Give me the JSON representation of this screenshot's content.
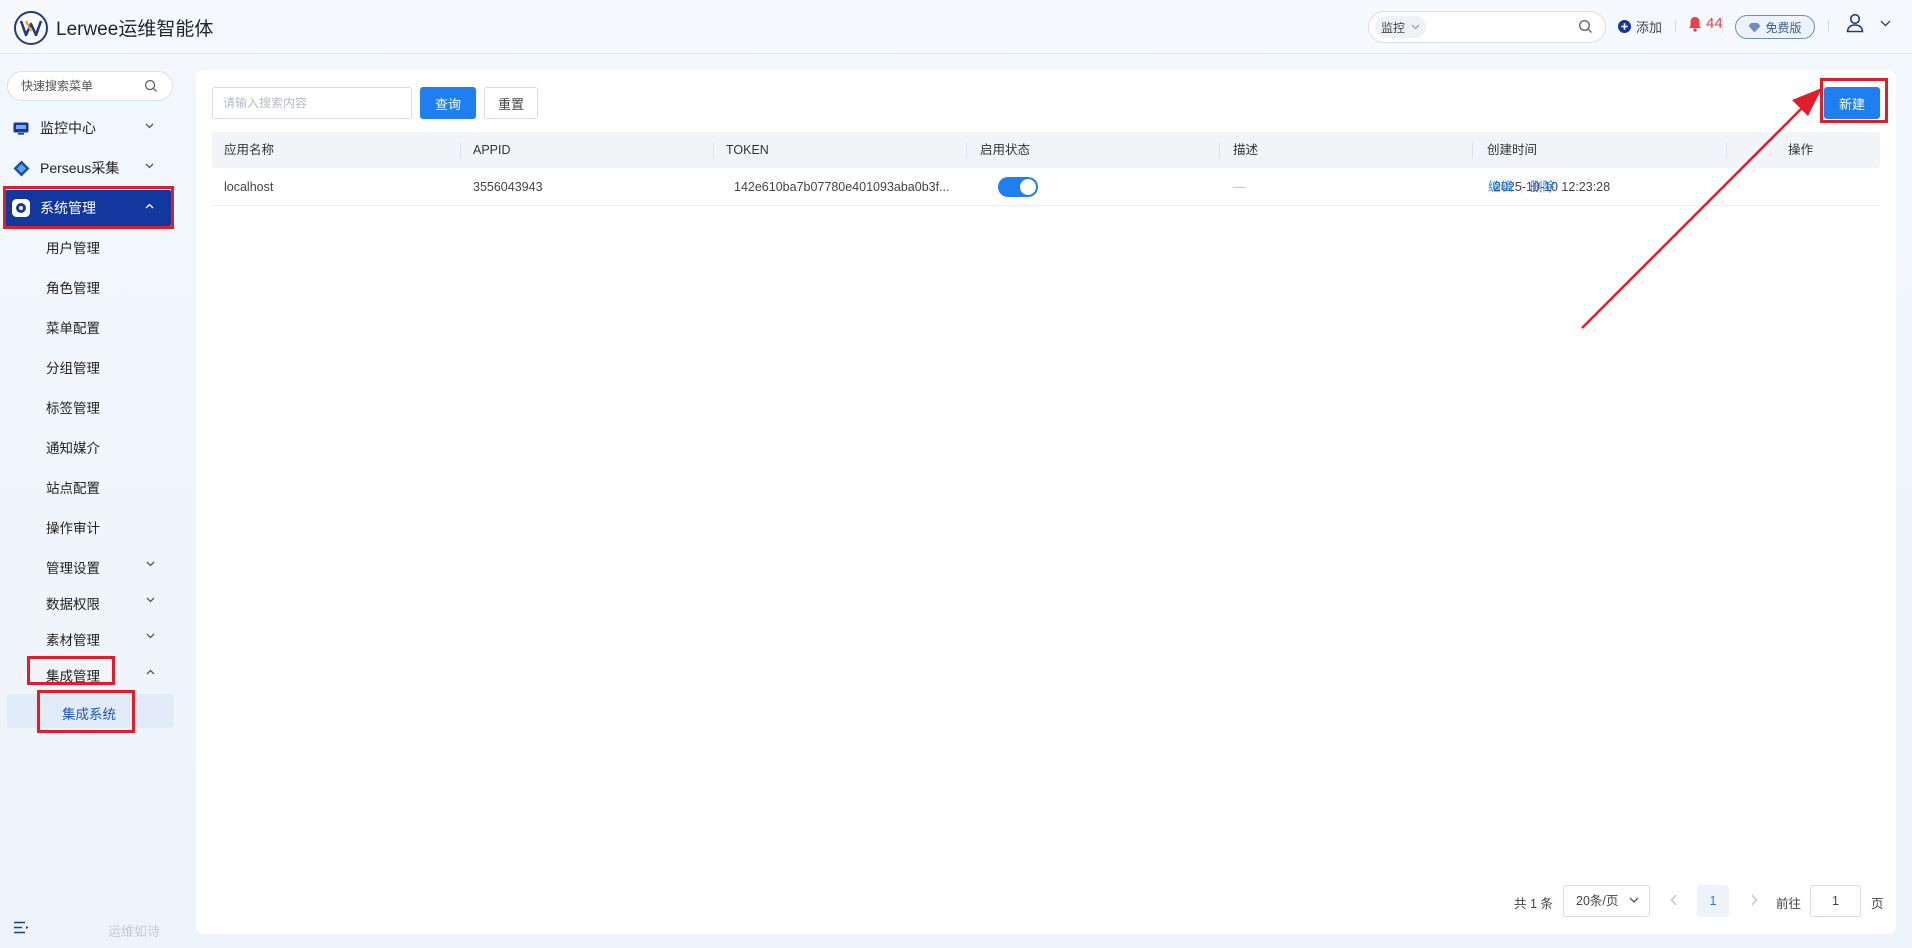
{
  "app": {
    "title": "Lerwee运维智能体"
  },
  "header": {
    "search_scope": "监控",
    "add_label": "添加",
    "alert_count": "44",
    "plan_label": "免费版"
  },
  "sidebar": {
    "search_placeholder": "快速搜索菜单",
    "top_items": [
      {
        "label": "监控中心",
        "icon": "monitor-icon"
      },
      {
        "label": "Perseus采集",
        "icon": "diamond-icon"
      },
      {
        "label": "系统管理",
        "icon": "gear-icon"
      }
    ],
    "sub_items": [
      {
        "label": "用户管理"
      },
      {
        "label": "角色管理"
      },
      {
        "label": "菜单配置"
      },
      {
        "label": "分组管理"
      },
      {
        "label": "标签管理"
      },
      {
        "label": "通知媒介"
      },
      {
        "label": "站点配置"
      },
      {
        "label": "操作审计"
      },
      {
        "label": "管理设置"
      },
      {
        "label": "数据权限"
      },
      {
        "label": "素材管理"
      },
      {
        "label": "集成管理"
      }
    ],
    "active_leaf": "集成系统",
    "footer_text": "运维如诗"
  },
  "toolbar": {
    "search_placeholder": "请输入搜索内容",
    "query_label": "查询",
    "reset_label": "重置",
    "new_label": "新建"
  },
  "table": {
    "columns": [
      "应用名称",
      "APPID",
      "TOKEN",
      "启用状态",
      "描述",
      "创建时间",
      "操作"
    ],
    "rows": [
      {
        "name": "localhost",
        "appid": "3556043943",
        "token": "142e610ba7b07780e401093aba0b3f...",
        "enabled": true,
        "description": "—",
        "created": "2025-10-10 12:23:28",
        "edit_label": "编辑",
        "delete_label": "删除"
      }
    ]
  },
  "pagination": {
    "total_label": "共 1 条",
    "page_size": "20条/页",
    "current_page": "1",
    "goto_label": "前往",
    "goto_value": "1",
    "page_suffix": "页"
  },
  "colors": {
    "accent": "#1f7ef0",
    "nav_active": "#1238a0",
    "alert": "#e8414b",
    "annotation": "#e11d2a"
  }
}
